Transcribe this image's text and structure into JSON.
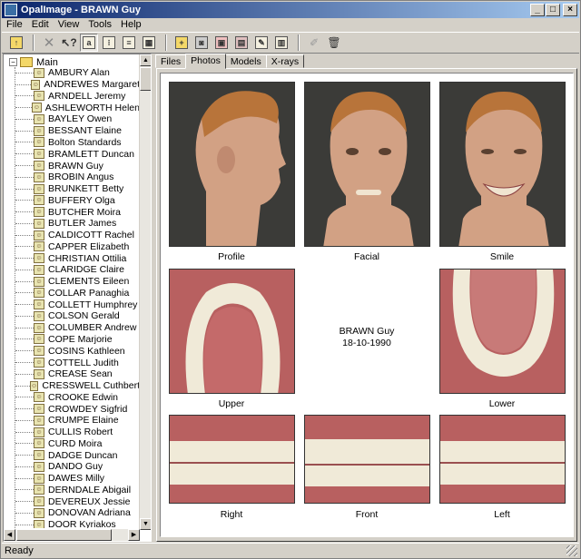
{
  "window": {
    "title": "OpalImage - BRAWN Guy"
  },
  "menu": [
    "File",
    "Edit",
    "View",
    "Tools",
    "Help"
  ],
  "tree": {
    "root": "Main",
    "items": [
      "AMBURY Alan",
      "ANDREWES Margaret",
      "ARNDELL Jeremy",
      "ASHLEWORTH Helen",
      "BAYLEY Owen",
      "BESSANT Elaine",
      "Bolton Standards",
      "BRAMLETT Duncan",
      "BRAWN Guy",
      "BROBIN Angus",
      "BRUNKETT Betty",
      "BUFFERY Olga",
      "BUTCHER Moira",
      "BUTLER James",
      "CALDICOTT Rachel",
      "CAPPER Elizabeth",
      "CHRISTIAN Ottilia",
      "CLARIDGE Claire",
      "CLEMENTS Eileen",
      "COLLAR Panaghia",
      "COLLETT Humphrey",
      "COLSON Gerald",
      "COLUMBER Andrew",
      "COPE Marjorie",
      "COSINS Kathleen",
      "COTTELL Judith",
      "CREASE Sean",
      "CRESSWELL Cuthbert",
      "CROOKE Edwin",
      "CROWDEY Sigfrid",
      "CRUMPE Elaine",
      "CULLIS Robert",
      "CURD Moira",
      "DADGE Duncan",
      "DANDO Guy",
      "DAWES Milly",
      "DERNDALE Abigail",
      "DEVEREUX Jessie",
      "DONOVAN Adriana",
      "DOOR Kyriakos"
    ]
  },
  "tabs": [
    "Files",
    "Photos",
    "Models",
    "X-rays"
  ],
  "photos": {
    "profile": "Profile",
    "facial": "Facial",
    "smile": "Smile",
    "upper": "Upper",
    "lower": "Lower",
    "right": "Right",
    "front": "Front",
    "left": "Left"
  },
  "patient": {
    "name": "BRAWN Guy",
    "dob": "18-10-1990"
  },
  "status": "Ready",
  "colors": {
    "titlebar": "#0a246a",
    "face_bg": "#3a3a3a",
    "skin": "#d4a58a",
    "gum": "#c86a6a",
    "tooth": "#f0ead8"
  }
}
